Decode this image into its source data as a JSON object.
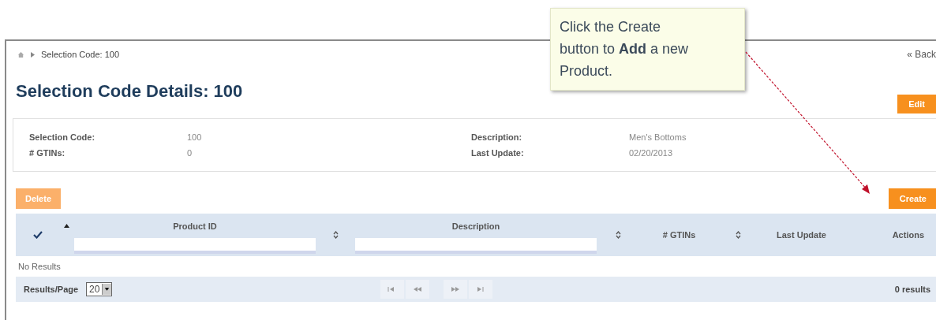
{
  "breadcrumb": {
    "current": "Selection Code: 100"
  },
  "back_link": "« Back",
  "title": "Selection Code Details: 100",
  "edit_button": "Edit",
  "details": [
    {
      "label": "Selection Code:",
      "value": "100"
    },
    {
      "label": "# GTINs:",
      "value": "0"
    },
    {
      "label": "Description:",
      "value": "Men's Bottoms"
    },
    {
      "label": "Last Update:",
      "value": "02/20/2013"
    }
  ],
  "delete_button": {
    "label": "Delete",
    "disabled": true
  },
  "create_button": {
    "label": "Create",
    "disabled": false
  },
  "table": {
    "columns": [
      {
        "kind": "select",
        "sortable": true,
        "sorted": true
      },
      {
        "kind": "text",
        "label": "Product ID",
        "filter": true,
        "sortable": true,
        "sorted": false
      },
      {
        "kind": "text",
        "label": "Description",
        "filter": true,
        "sortable": true,
        "sorted": false
      },
      {
        "kind": "text",
        "label": "# GTINs",
        "filter": false,
        "sortable": true,
        "sorted": false
      },
      {
        "kind": "text",
        "label": "Last Update",
        "filter": false,
        "sortable": false
      },
      {
        "kind": "text",
        "label": "Actions",
        "filter": false,
        "sortable": false
      }
    ],
    "empty_message": "No Results"
  },
  "footer": {
    "results_per_page_label": "Results/Page",
    "page_size": "20",
    "results_count": "0 results"
  },
  "callout": {
    "text": "Click the Create button to **Add** a new Product."
  }
}
